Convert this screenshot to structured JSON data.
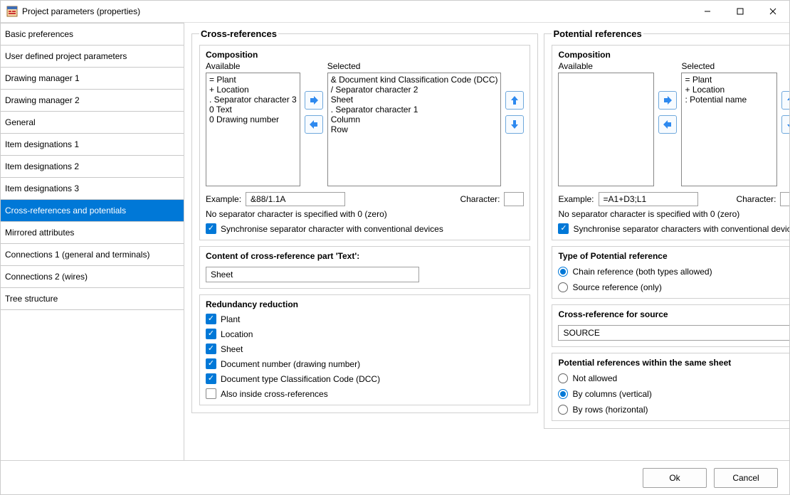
{
  "window": {
    "title": "Project parameters (properties)"
  },
  "sidebar": {
    "items": [
      "Basic preferences",
      "User defined project parameters",
      "Drawing manager 1",
      "Drawing manager 2",
      "General",
      "Item designations 1",
      "Item designations 2",
      "Item designations 3",
      "Cross-references and potentials",
      "Mirrored attributes",
      "Connections 1 (general and terminals)",
      "Connections 2 (wires)",
      "Tree structure"
    ],
    "selected_index": 8
  },
  "cross_ref": {
    "legend": "Cross-references",
    "composition": {
      "legend": "Composition",
      "available_label": "Available",
      "available_items": "= Plant\n+ Location\n. Separator character 3\n0 Text\n0 Drawing number",
      "selected_label": "Selected",
      "selected_items": "& Document kind Classification Code (DCC)\n/ Separator character 2\nSheet\n. Separator character 1\nColumn\nRow",
      "example_label": "Example:",
      "example_value": "&88/1.1A",
      "character_label": "Character:",
      "hint": "No separator character is specified with 0 (zero)",
      "sync_label": "Synchronise separator character with conventional devices",
      "sync_checked": true
    },
    "content_text": {
      "legend": "Content of cross-reference part 'Text':",
      "value": "Sheet"
    },
    "redundancy": {
      "legend": "Redundancy reduction",
      "items": [
        {
          "label": "Plant",
          "checked": true
        },
        {
          "label": "Location",
          "checked": true
        },
        {
          "label": "Sheet",
          "checked": true
        },
        {
          "label": "Document number (drawing number)",
          "checked": true
        },
        {
          "label": "Document type Classification Code (DCC)",
          "checked": true
        },
        {
          "label": "Also inside cross-references",
          "checked": false
        }
      ]
    }
  },
  "potential": {
    "legend": "Potential references",
    "composition": {
      "legend": "Composition",
      "available_label": "Available",
      "available_items": "",
      "selected_label": "Selected",
      "selected_items": "= Plant\n+ Location\n: Potential name",
      "example_label": "Example:",
      "example_value": "=A1+D3;L1",
      "character_label": "Character:",
      "hint": "No separator character is specified with 0 (zero)",
      "sync_label": "Synchronise separator characters with conventional devices",
      "sync_checked": true
    },
    "type": {
      "legend": "Type of Potential reference",
      "options": [
        {
          "label": "Chain reference (both types allowed)",
          "checked": true
        },
        {
          "label": "Source reference (only)",
          "checked": false
        }
      ]
    },
    "source": {
      "legend": "Cross-reference for source",
      "value": "SOURCE"
    },
    "same_sheet": {
      "legend": "Potential references within the same sheet",
      "options": [
        {
          "label": "Not allowed",
          "checked": false
        },
        {
          "label": "By columns (vertical)",
          "checked": true
        },
        {
          "label": "By rows (horizontal)",
          "checked": false
        }
      ]
    }
  },
  "footer": {
    "ok": "Ok",
    "cancel": "Cancel"
  }
}
